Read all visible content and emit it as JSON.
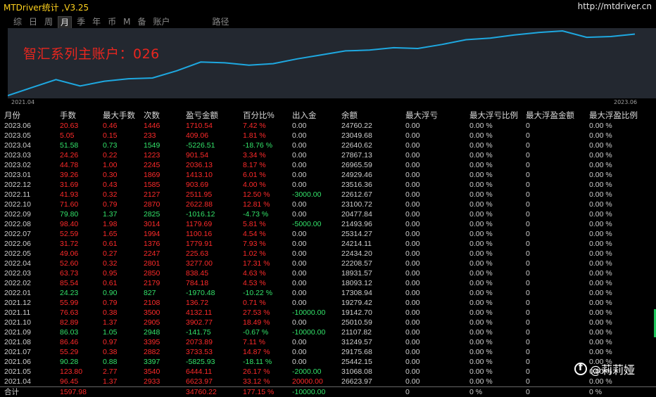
{
  "app": {
    "title": "MTDriver统计 ,V3.25",
    "url": "http://mtdriver.cn"
  },
  "tabs": [
    "综",
    "日",
    "周",
    "月",
    "季",
    "年",
    "币",
    "M",
    "备",
    "账户",
    "路径"
  ],
  "active_tab": "月",
  "chart": {
    "caption": "智汇系列主账户：026",
    "x_start_label": "2021.04",
    "x_end_label": "2023.06",
    "line_color": "#1ea8e0",
    "balance_series": [
      0,
      1,
      2,
      1.2,
      1.8,
      2.1,
      2.2,
      3.1,
      4.2,
      4.1,
      3.8,
      4.0,
      4.6,
      5.1,
      5.6,
      5.7,
      6.0,
      5.9,
      6.4,
      7.0,
      7.2,
      7.6,
      7.9,
      8.1,
      7.3,
      7.4,
      7.7
    ]
  },
  "table": {
    "headers": [
      "月份",
      "手数",
      "最大手数",
      "次数",
      "盈亏金额",
      "百分比%",
      "出入金",
      "余额",
      "最大浮亏",
      "最大浮亏比例",
      "最大浮盈金额",
      "最大浮盈比例"
    ],
    "rows": [
      [
        "2023.06",
        "20.63",
        "0.46",
        "1446",
        "1710.54",
        "7.42 %",
        "0.00",
        "24760.22",
        "0.00",
        "0.00 %",
        "0",
        "0.00 %"
      ],
      [
        "2023.05",
        "5.05",
        "0.15",
        "233",
        "409.06",
        "1.81 %",
        "0.00",
        "23049.68",
        "0.00",
        "0.00 %",
        "0",
        "0.00 %"
      ],
      [
        "2023.04",
        "51.58",
        "0.73",
        "1549",
        "-5226.51",
        "-18.76 %",
        "0.00",
        "22640.62",
        "0.00",
        "0.00 %",
        "0",
        "0.00 %"
      ],
      [
        "2023.03",
        "24.26",
        "0.22",
        "1223",
        "901.54",
        "3.34 %",
        "0.00",
        "27867.13",
        "0.00",
        "0.00 %",
        "0",
        "0.00 %"
      ],
      [
        "2023.02",
        "44.78",
        "1.00",
        "2245",
        "2036.13",
        "8.17 %",
        "0.00",
        "26965.59",
        "0.00",
        "0.00 %",
        "0",
        "0.00 %"
      ],
      [
        "2023.01",
        "39.26",
        "0.30",
        "1869",
        "1413.10",
        "6.01 %",
        "0.00",
        "24929.46",
        "0.00",
        "0.00 %",
        "0",
        "0.00 %"
      ],
      [
        "2022.12",
        "31.69",
        "0.43",
        "1585",
        "903.69",
        "4.00 %",
        "0.00",
        "23516.36",
        "0.00",
        "0.00 %",
        "0",
        "0.00 %"
      ],
      [
        "2022.11",
        "41.93",
        "0.32",
        "2127",
        "2511.95",
        "12.50 %",
        "-3000.00",
        "22612.67",
        "0.00",
        "0.00 %",
        "0",
        "0.00 %"
      ],
      [
        "2022.10",
        "71.60",
        "0.79",
        "2870",
        "2622.88",
        "12.81 %",
        "0.00",
        "23100.72",
        "0.00",
        "0.00 %",
        "0",
        "0.00 %"
      ],
      [
        "2022.09",
        "79.80",
        "1.37",
        "2825",
        "-1016.12",
        "-4.73 %",
        "0.00",
        "20477.84",
        "0.00",
        "0.00 %",
        "0",
        "0.00 %"
      ],
      [
        "2022.08",
        "98.40",
        "1.98",
        "3014",
        "1179.69",
        "5.81 %",
        "-5000.00",
        "21493.96",
        "0.00",
        "0.00 %",
        "0",
        "0.00 %"
      ],
      [
        "2022.07",
        "52.59",
        "1.65",
        "1994",
        "1100.16",
        "4.54 %",
        "0.00",
        "25314.27",
        "0.00",
        "0.00 %",
        "0",
        "0.00 %"
      ],
      [
        "2022.06",
        "31.72",
        "0.61",
        "1376",
        "1779.91",
        "7.93 %",
        "0.00",
        "24214.11",
        "0.00",
        "0.00 %",
        "0",
        "0.00 %"
      ],
      [
        "2022.05",
        "49.06",
        "0.27",
        "2247",
        "225.63",
        "1.02 %",
        "0.00",
        "22434.20",
        "0.00",
        "0.00 %",
        "0",
        "0.00 %"
      ],
      [
        "2022.04",
        "52.60",
        "0.32",
        "2801",
        "3277.00",
        "17.31 %",
        "0.00",
        "22208.57",
        "0.00",
        "0.00 %",
        "0",
        "0.00 %"
      ],
      [
        "2022.03",
        "63.73",
        "0.95",
        "2850",
        "838.45",
        "4.63 %",
        "0.00",
        "18931.57",
        "0.00",
        "0.00 %",
        "0",
        "0.00 %"
      ],
      [
        "2022.02",
        "85.54",
        "0.61",
        "2179",
        "784.18",
        "4.53 %",
        "0.00",
        "18093.12",
        "0.00",
        "0.00 %",
        "0",
        "0.00 %"
      ],
      [
        "2022.01",
        "24.23",
        "0.90",
        "827",
        "-1970.48",
        "-10.22 %",
        "0.00",
        "17308.94",
        "0.00",
        "0.00 %",
        "0",
        "0.00 %"
      ],
      [
        "2021.12",
        "55.99",
        "0.79",
        "2108",
        "136.72",
        "0.71 %",
        "0.00",
        "19279.42",
        "0.00",
        "0.00 %",
        "0",
        "0.00 %"
      ],
      [
        "2021.11",
        "76.63",
        "0.38",
        "3500",
        "4132.11",
        "27.53 %",
        "-10000.00",
        "19142.70",
        "0.00",
        "0.00 %",
        "0",
        "0.00 %"
      ],
      [
        "2021.10",
        "82.89",
        "1.37",
        "2905",
        "3902.77",
        "18.49 %",
        "0.00",
        "25010.59",
        "0.00",
        "0.00 %",
        "0",
        "0.00 %"
      ],
      [
        "2021.09",
        "86.03",
        "1.05",
        "2948",
        "-141.75",
        "-0.67 %",
        "-10000.00",
        "21107.82",
        "0.00",
        "0.00 %",
        "0",
        "0.00 %"
      ],
      [
        "2021.08",
        "86.46",
        "0.97",
        "3395",
        "2073.89",
        "7.11 %",
        "0.00",
        "31249.57",
        "0.00",
        "0.00 %",
        "0",
        "0.00 %"
      ],
      [
        "2021.07",
        "55.29",
        "0.38",
        "2882",
        "3733.53",
        "14.87 %",
        "0.00",
        "29175.68",
        "0.00",
        "0.00 %",
        "0",
        "0.00 %"
      ],
      [
        "2021.06",
        "90.28",
        "0.88",
        "3397",
        "-5825.93",
        "-18.11 %",
        "0.00",
        "25442.15",
        "0.00",
        "0.00 %",
        "0",
        "0.00 %"
      ],
      [
        "2021.05",
        "123.80",
        "2.77",
        "3540",
        "6444.11",
        "26.17 %",
        "-2000.00",
        "31068.08",
        "0.00",
        "0.00 %",
        "0",
        "0.00 %"
      ],
      [
        "2021.04",
        "96.45",
        "1.37",
        "2933",
        "6623.97",
        "33.12 %",
        "20000.00",
        "26623.97",
        "0.00",
        "0.00 %",
        "0",
        "0.00 %"
      ]
    ],
    "total": [
      "合计",
      "1597.98",
      "",
      "",
      "34760.22",
      "177.15 %",
      "-10000.00",
      "",
      "0",
      "0 %",
      "0",
      "0 %"
    ]
  },
  "watermark": "@莉莉娅",
  "colors": {
    "gain": "#ff2a2a",
    "loss": "#33e36a",
    "chart_bg": "#232830",
    "title": "#ffd21e"
  }
}
